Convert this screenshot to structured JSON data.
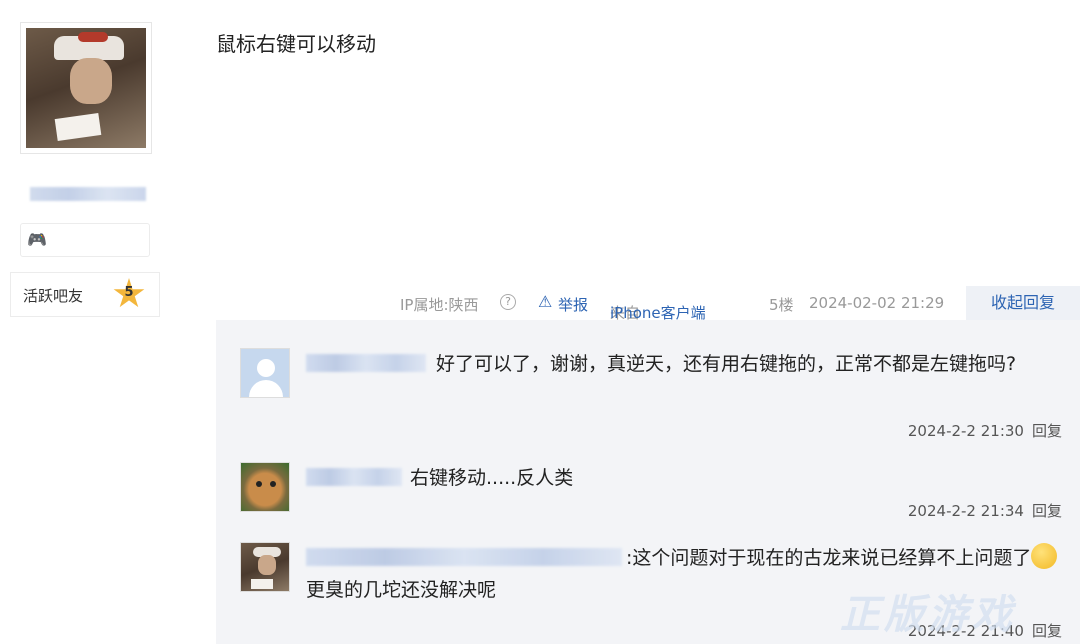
{
  "user": {
    "level_title": "活跃吧友",
    "level_number": "5"
  },
  "post": {
    "content": "鼠标右键可以移动",
    "ip_location": "IP属地:陕西",
    "report_label": "举报",
    "client_prefix": "来自",
    "client_name": "iPhone客户端",
    "floor": "5楼",
    "time": "2024-02-02 21:29",
    "collapse_label": "收起回复"
  },
  "replies": [
    {
      "text": "好了可以了，谢谢，真逆天，还有用右键拖的，正常不都是左键拖吗?",
      "time": "2024-2-2 21:30",
      "reply_label": "回复"
    },
    {
      "text": "右键移动.....反人类",
      "time": "2024-2-2 21:34",
      "reply_label": "回复"
    },
    {
      "text_before": ":这个问题对于现在的古龙来说已经算不上问题了",
      "text_after": "更臭的几坨还没解决呢",
      "time": "2024-2-2 21:40",
      "reply_label": "回复"
    }
  ],
  "icons": {
    "help": "?",
    "report": "⚠",
    "gamepad": "🎮"
  }
}
